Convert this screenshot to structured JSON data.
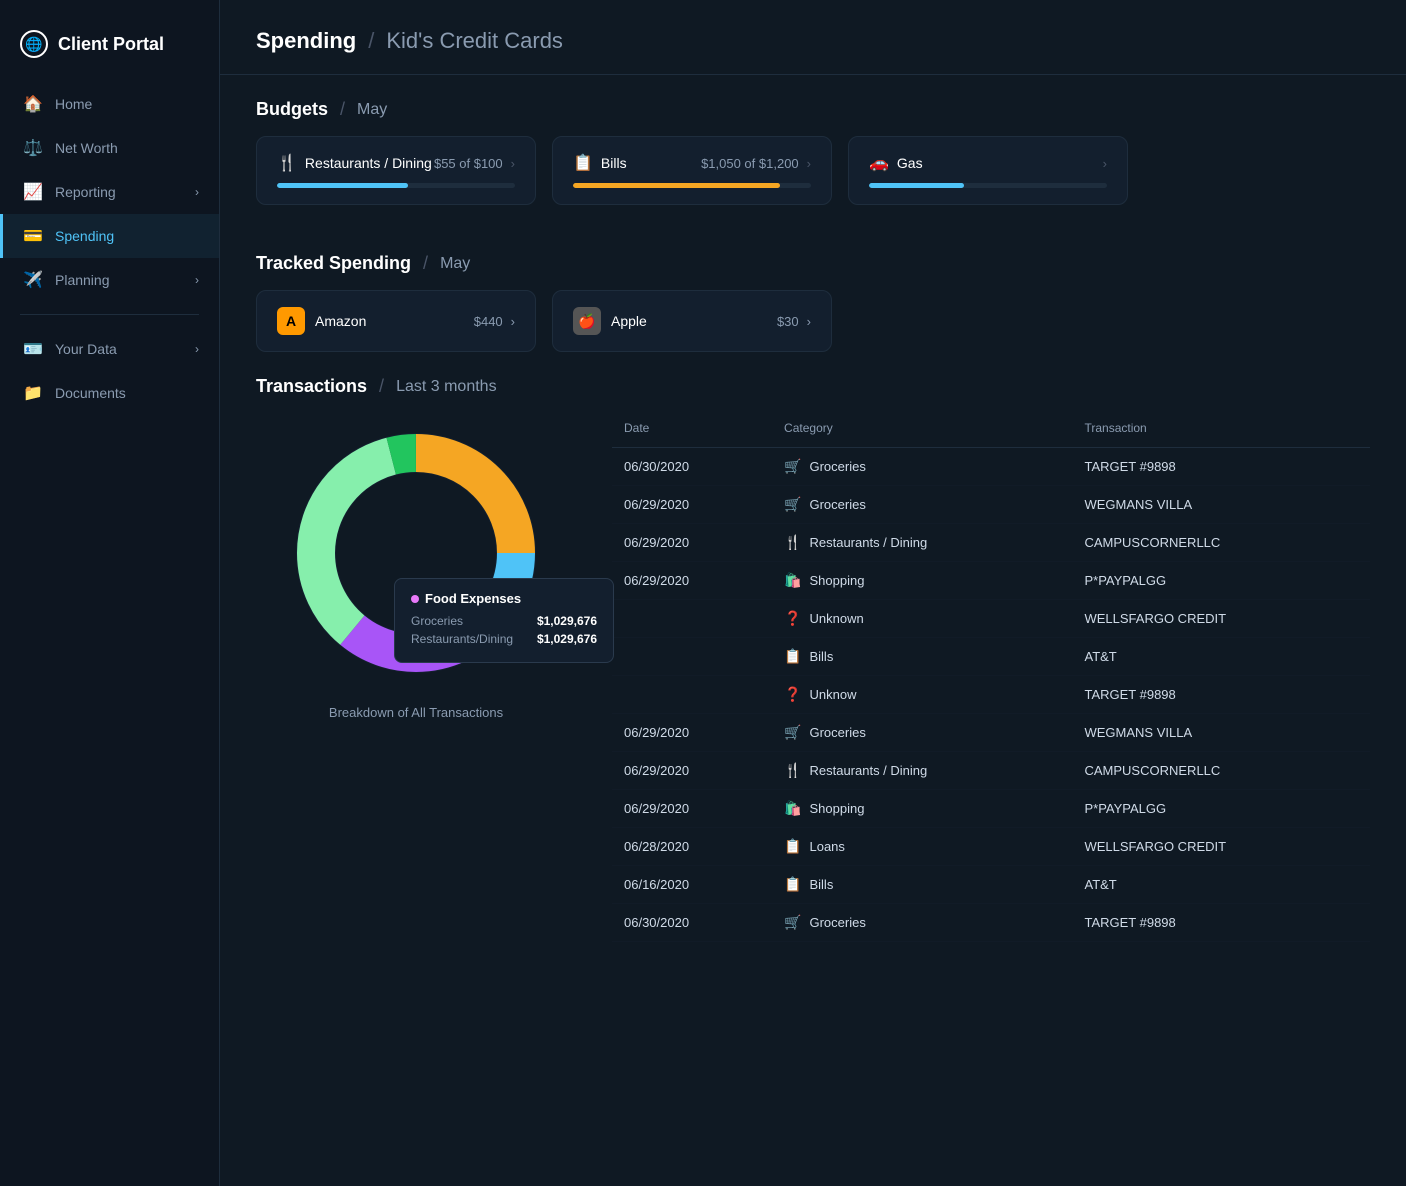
{
  "app": {
    "title": "Client Portal"
  },
  "sidebar": {
    "items": [
      {
        "id": "home",
        "label": "Home",
        "icon": "🏠",
        "active": false
      },
      {
        "id": "net-worth",
        "label": "Net Worth",
        "icon": "⚖️",
        "active": false
      },
      {
        "id": "reporting",
        "label": "Reporting",
        "icon": "📈",
        "active": false,
        "arrow": "›"
      },
      {
        "id": "spending",
        "label": "Spending",
        "icon": "💳",
        "active": true
      },
      {
        "id": "planning",
        "label": "Planning",
        "icon": "✈️",
        "active": false,
        "arrow": "›"
      },
      {
        "id": "your-data",
        "label": "Your Data",
        "icon": "🪪",
        "active": false,
        "arrow": "›"
      },
      {
        "id": "documents",
        "label": "Documents",
        "icon": "📁",
        "active": false
      }
    ]
  },
  "page": {
    "breadcrumb_main": "Spending",
    "breadcrumb_sub": "Kid's Credit Cards",
    "budgets_label": "Budgets",
    "budgets_period": "May",
    "tracked_label": "Tracked Spending",
    "tracked_period": "May",
    "transactions_label": "Transactions",
    "transactions_period": "Last 3 months",
    "chart_label": "Breakdown of All Transactions"
  },
  "budgets": [
    {
      "icon": "🍴",
      "label": "Restaurants / Dining",
      "amount": "$55 of $100",
      "progress": 55,
      "color": "blue"
    },
    {
      "icon": "📋",
      "label": "Bills",
      "amount": "$1,050 of $1,200",
      "progress": 87,
      "color": "yellow"
    },
    {
      "icon": "🚗",
      "label": "Gas",
      "amount": "",
      "progress": 40,
      "color": "blue"
    }
  ],
  "tracked": [
    {
      "id": "amazon",
      "icon": "A",
      "label": "Amazon",
      "amount": "$440"
    },
    {
      "id": "apple",
      "icon": "🍎",
      "label": "Apple",
      "amount": "$30"
    }
  ],
  "transactions": {
    "columns": [
      "Date",
      "Category",
      "Transaction"
    ],
    "rows": [
      {
        "date": "06/30/2020",
        "category": "Groceries",
        "category_icon": "🛒",
        "transaction": "TARGET #9898"
      },
      {
        "date": "06/29/2020",
        "category": "Groceries",
        "category_icon": "🛒",
        "transaction": "WEGMANS VILLA"
      },
      {
        "date": "06/29/2020",
        "category": "Restaurants / Dining",
        "category_icon": "🍴",
        "transaction": "CAMPUSCORNERLLC"
      },
      {
        "date": "06/29/2020",
        "category": "Shopping",
        "category_icon": "🛍️",
        "transaction": "P*PAYPALGG"
      },
      {
        "date": "",
        "category": "Unknown",
        "category_icon": "❓",
        "transaction": "WELLSFARGO CREDIT"
      },
      {
        "date": "",
        "category": "Bills",
        "category_icon": "📋",
        "transaction": "AT&T"
      },
      {
        "date": "",
        "category": "Unknow",
        "category_icon": "❓",
        "transaction": "TARGET #9898"
      },
      {
        "date": "06/29/2020",
        "category": "Groceries",
        "category_icon": "🛒",
        "transaction": "WEGMANS VILLA"
      },
      {
        "date": "06/29/2020",
        "category": "Restaurants / Dining",
        "category_icon": "🍴",
        "transaction": "CAMPUSCORNERLLC"
      },
      {
        "date": "06/29/2020",
        "category": "Shopping",
        "category_icon": "🛍️",
        "transaction": "P*PAYPALGG"
      },
      {
        "date": "06/28/2020",
        "category": "Loans",
        "category_icon": "📋",
        "transaction": "WELLSFARGO CREDIT"
      },
      {
        "date": "06/16/2020",
        "category": "Bills",
        "category_icon": "📋",
        "transaction": "AT&T"
      },
      {
        "date": "06/30/2020",
        "category": "Groceries",
        "category_icon": "🛒",
        "transaction": "TARGET #9898"
      }
    ]
  },
  "tooltip": {
    "title": "Food Expenses",
    "rows": [
      {
        "label": "Groceries",
        "value": "$1,029,676"
      },
      {
        "label": "Restaurants/Dining",
        "value": "$1,029,676"
      }
    ]
  },
  "chart": {
    "segments": [
      {
        "label": "Orange",
        "color": "#f5a623",
        "percent": 25
      },
      {
        "label": "Blue",
        "color": "#4fc3f7",
        "percent": 15
      },
      {
        "label": "DarkBlue",
        "color": "#1e3a5f",
        "percent": 3
      },
      {
        "label": "Purple",
        "color": "#a855f7",
        "percent": 18
      },
      {
        "label": "LightGreen",
        "color": "#86efac",
        "percent": 35
      },
      {
        "label": "Green",
        "color": "#22c55e",
        "percent": 4
      }
    ]
  }
}
